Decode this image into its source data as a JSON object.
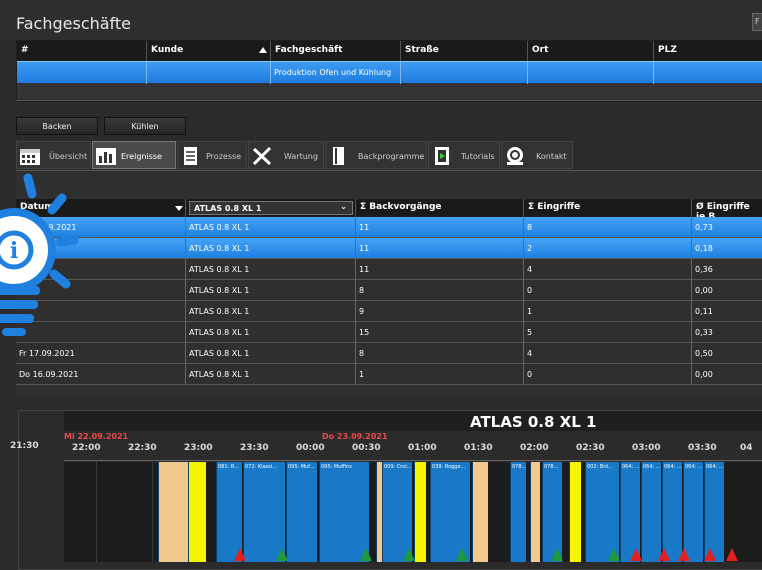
{
  "window": {
    "title": "Fachgeschäfte",
    "corner_label": "F"
  },
  "shops": {
    "columns": [
      "#",
      "Kunde",
      "Fachgeschäft",
      "Straße",
      "Ort",
      "PLZ"
    ],
    "rows": [
      {
        "num": "",
        "kunde": "",
        "fachgeschaeft": "Produktion Ofen und  Kühlung",
        "strasse": "",
        "ort": "",
        "plz": ""
      }
    ]
  },
  "mode_buttons": {
    "backen": "Backen",
    "kuehlen": "Kühlen"
  },
  "tabs": [
    {
      "label": "Übersicht",
      "icon": "calendar-icon"
    },
    {
      "label": "Ereignisse",
      "icon": "bar-chart-icon"
    },
    {
      "label": "Prozesse",
      "icon": "document-icon"
    },
    {
      "label": "Wartung",
      "icon": "tools-icon"
    },
    {
      "label": "Backprogramme",
      "icon": "book-icon"
    },
    {
      "label": "Tutorials",
      "icon": "film-icon"
    },
    {
      "label": "Kontakt",
      "icon": "contact-icon"
    }
  ],
  "events": {
    "columns": {
      "datum": "Datum",
      "oven_filter": "ATLAS 0.8 XL 1",
      "backvorgaenge": "Σ Backvorgänge",
      "eingriffe": "Σ Eingriffe",
      "eingriffe_je": "Ø Eingriffe je B"
    },
    "rows": [
      {
        "datum": "Mi 22.09.2021",
        "oven": "ATLAS 0.8 XL 1",
        "back": "11",
        "eingr": "8",
        "avg": "0,73"
      },
      {
        "datum": "",
        "oven": "ATLAS 0.8 XL 1",
        "back": "11",
        "eingr": "2",
        "avg": "0,18"
      },
      {
        "datum": "",
        "oven": "ATLAS 0.8 XL 1",
        "back": "11",
        "eingr": "4",
        "avg": "0,36"
      },
      {
        "datum": "",
        "oven": "ATLAS 0.8 XL 1",
        "back": "8",
        "eingr": "0",
        "avg": "0,00"
      },
      {
        "datum": "",
        "oven": "ATLAS 0.8 XL 1",
        "back": "9",
        "eingr": "1",
        "avg": "0,11"
      },
      {
        "datum": "",
        "oven": "ATLAS 0.8 XL 1",
        "back": "15",
        "eingr": "5",
        "avg": "0,33"
      },
      {
        "datum": "Fr 17.09.2021",
        "oven": "ATLAS 0.8 XL 1",
        "back": "8",
        "eingr": "4",
        "avg": "0,50"
      },
      {
        "datum": "Do 16.09.2021",
        "oven": "ATLAS 0.8 XL 1",
        "back": "1",
        "eingr": "0",
        "avg": "0,00"
      }
    ]
  },
  "timeline": {
    "title": "ATLAS 0.8 XL 1",
    "date_left": "Mi 22.09.2021",
    "date_mid": "Do 23.09.2021",
    "ticks": [
      "21:30",
      "22:00",
      "22:30",
      "23:00",
      "23:30",
      "00:00",
      "00:30",
      "01:00",
      "01:30",
      "02:00",
      "02:30",
      "03:00",
      "03:30",
      "04"
    ],
    "bars": [
      {
        "label": "",
        "color": "#f2c98c"
      },
      {
        "label": "",
        "color": "#f5f500"
      },
      {
        "label": "081: R...",
        "color": "#1879c9"
      },
      {
        "label": "072: Klassi...",
        "color": "#1879c9"
      },
      {
        "label": "095: Muf...",
        "color": "#1879c9"
      },
      {
        "label": "095: Muffins",
        "color": "#1879c9"
      },
      {
        "label": "",
        "color": "#f2c98c"
      },
      {
        "label": "009: Croi...",
        "color": "#1879c9"
      },
      {
        "label": "",
        "color": "#f5f500"
      },
      {
        "label": "039: Rogge...",
        "color": "#1879c9"
      },
      {
        "label": "",
        "color": "#f2c98c"
      },
      {
        "label": "078...",
        "color": "#1879c9"
      },
      {
        "label": "",
        "color": "#f2c98c"
      },
      {
        "label": "078...",
        "color": "#1879c9"
      },
      {
        "label": "",
        "color": "#f5f500"
      },
      {
        "label": "002: Brö...",
        "color": "#1879c9"
      },
      {
        "label": "064: ...",
        "color": "#1879c9"
      },
      {
        "label": "064: ...",
        "color": "#1879c9"
      },
      {
        "label": "064: ...",
        "color": "#1879c9"
      },
      {
        "label": "064: ...",
        "color": "#1879c9"
      },
      {
        "label": "064: ...",
        "color": "#1879c9"
      }
    ]
  },
  "colors": {
    "selection": "#2a8ae8",
    "accent_red": "#e84a4a",
    "bar_blue": "#1879c9",
    "yellow": "#f5f500",
    "peach": "#f2c98c",
    "green_marker": "#1f9a3a",
    "red_marker": "#e02020"
  },
  "overlay": {
    "icon": "lightbulb-info-icon"
  }
}
